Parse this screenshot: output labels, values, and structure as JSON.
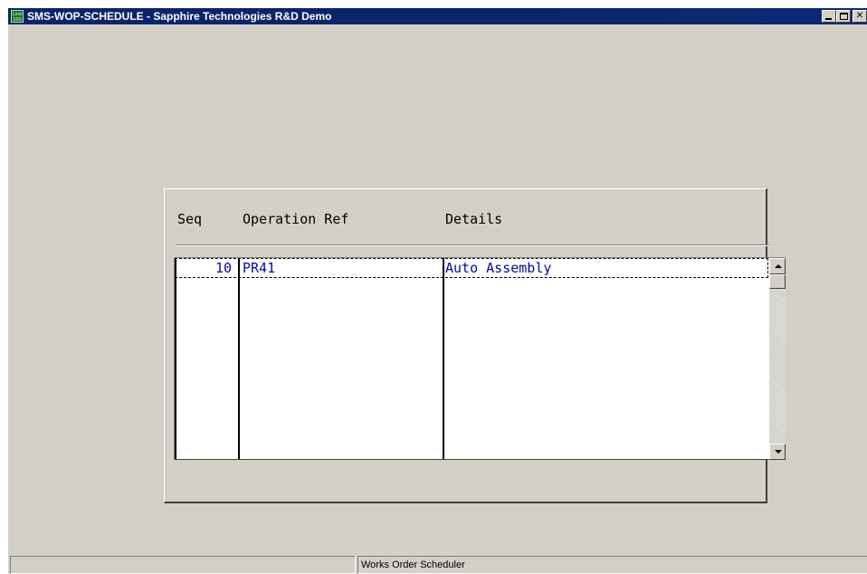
{
  "window": {
    "title": "SMS-WOP-SCHEDULE - Sapphire Technologies R&D Demo",
    "app_icon_label": "Line 100",
    "buttons": [
      "minimize",
      "maximize",
      "close"
    ]
  },
  "grid": {
    "headers": {
      "seq": "Seq",
      "operation_ref": "Operation Ref",
      "details": "Details"
    },
    "rows": [
      {
        "seq": "10",
        "operation_ref": "PR41",
        "details": "Auto Assembly"
      }
    ],
    "selected_row": 0
  },
  "statusbar": {
    "left": "",
    "right": "Works Order Scheduler"
  },
  "colors": {
    "titlebar": "#0a246a",
    "face": "#d4d0c8",
    "cell_text": "#0a0a9a"
  }
}
